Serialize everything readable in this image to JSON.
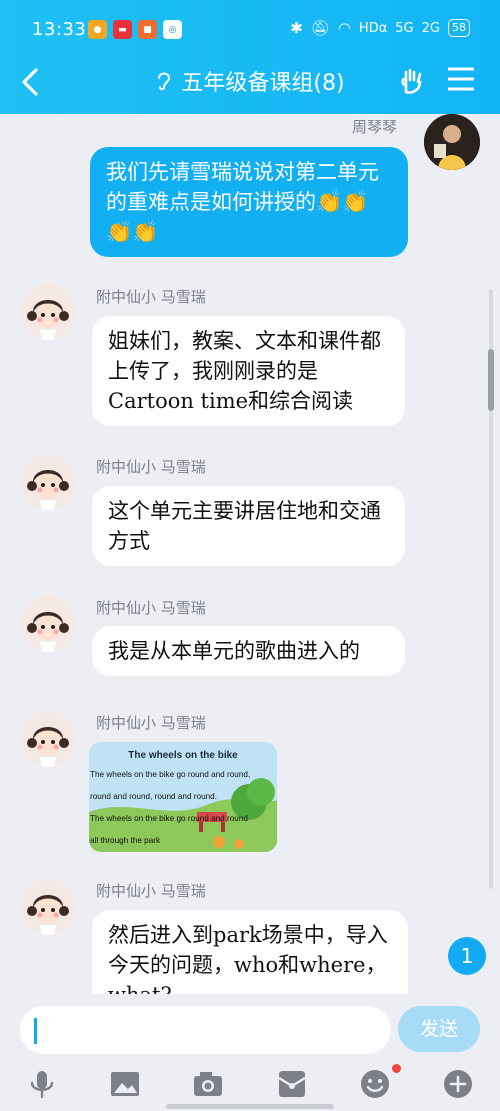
{
  "status_bar": {
    "time": "13:33",
    "network": "HDα",
    "signal1": "5G",
    "signal2": "2G",
    "battery": "58"
  },
  "header": {
    "title": "五年级备课组(8)"
  },
  "messages": [
    {
      "sender": "周琴琴",
      "text": "我们先请雪瑞说说对第二单元的重难点是如何讲授的👏👏👏👏",
      "mine": true
    },
    {
      "sender": "附中仙小 马雪瑞",
      "text": "姐妹们，教案、文本和课件都上传了，我刚刚录的是Cartoon time和综合阅读"
    },
    {
      "sender": "附中仙小 马雪瑞",
      "text": "这个单元主要讲居住地和交通方式"
    },
    {
      "sender": "附中仙小 马雪瑞",
      "text": "我是从本单元的歌曲进入的"
    },
    {
      "sender": "附中仙小 马雪瑞",
      "image": {
        "title": "The wheels on the bike",
        "line1": "The wheels on the bike go round and round,",
        "line2": "round and round, round and round.",
        "line3": "The wheels on the bike go round and round",
        "line4": "all through the park"
      }
    },
    {
      "sender": "附中仙小 马雪瑞",
      "text": "然后进入到park场景中，导入今天的问题，who和where，what?"
    }
  ],
  "new_message_count": "1",
  "input": {
    "send_label": "发送"
  },
  "toolbar": [
    "microphone-icon",
    "image-icon",
    "camera-icon",
    "red-packet-icon",
    "emoji-icon",
    "plus-icon"
  ]
}
